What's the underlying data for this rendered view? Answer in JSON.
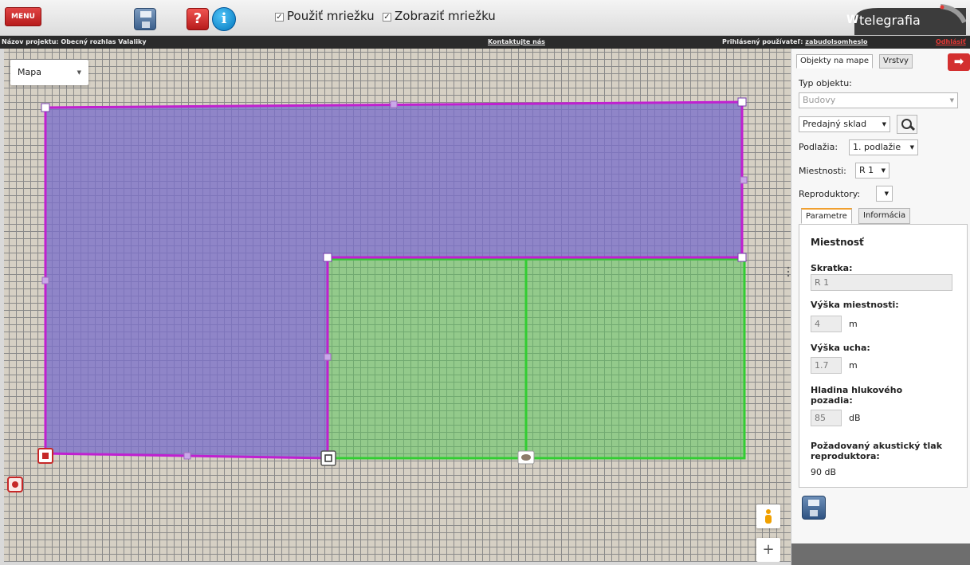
{
  "toolbar": {
    "menu_label": "MENU",
    "save_icon": "save-icon",
    "help_glyph": "?",
    "info_glyph": "i",
    "use_grid_label": "Použiť mriežku",
    "show_grid_label": "Zobraziť mriežku",
    "use_grid_checked": true,
    "show_grid_checked": true,
    "logo_text": "telegrafia"
  },
  "infobar": {
    "project_label": "Názov projektu: Obecný rozhlas Valaliky",
    "contact_label": "Kontaktujte nás",
    "user_prefix": "Prihlásený používateľ: ",
    "user_name": "zabudolsomheslo",
    "logout_label": "Odhlásiť"
  },
  "map": {
    "type_selector": "Mapa",
    "colors": {
      "room_purple": "#7b6fc9",
      "room_green": "#5cc45c",
      "outline_purple": "#c020d0",
      "outline_green": "#32cd32"
    },
    "controls": {
      "pegman_icon": "pegman-icon",
      "zoom_in": "+"
    }
  },
  "panel": {
    "tabs": [
      "Objekty na mape",
      "Vrstvy"
    ],
    "active_tab": "Objekty na mape",
    "exit_icon": "arrow-right-icon",
    "object_type_label": "Typ objektu:",
    "object_type_value": "Budovy",
    "building_value": "Predajný sklad",
    "floors_label": "Podlažia:",
    "floors_value": "1. podlažie",
    "rooms_label": "Miestnosti:",
    "rooms_value": "R 1",
    "speakers_label": "Reproduktory:",
    "speakers_value": "",
    "sub_tabs": [
      "Parametre",
      "Informácia"
    ],
    "active_sub_tab": "Parametre",
    "params": {
      "title": "Miestnosť",
      "abbr_label": "Skratka:",
      "abbr_value": "R 1",
      "room_height_label": "Výška miestnosti:",
      "room_height_value": "4",
      "room_height_unit": "m",
      "ear_height_label": "Výška ucha:",
      "ear_height_value": "1.7",
      "ear_height_unit": "m",
      "noise_label_1": "Hladina hlukového",
      "noise_label_2": "pozadia:",
      "noise_value": "85",
      "noise_unit": "dB",
      "spl_label_1": "Požadovaný akustický tlak",
      "spl_label_2": "reproduktora:",
      "spl_value": "90 dB"
    }
  }
}
